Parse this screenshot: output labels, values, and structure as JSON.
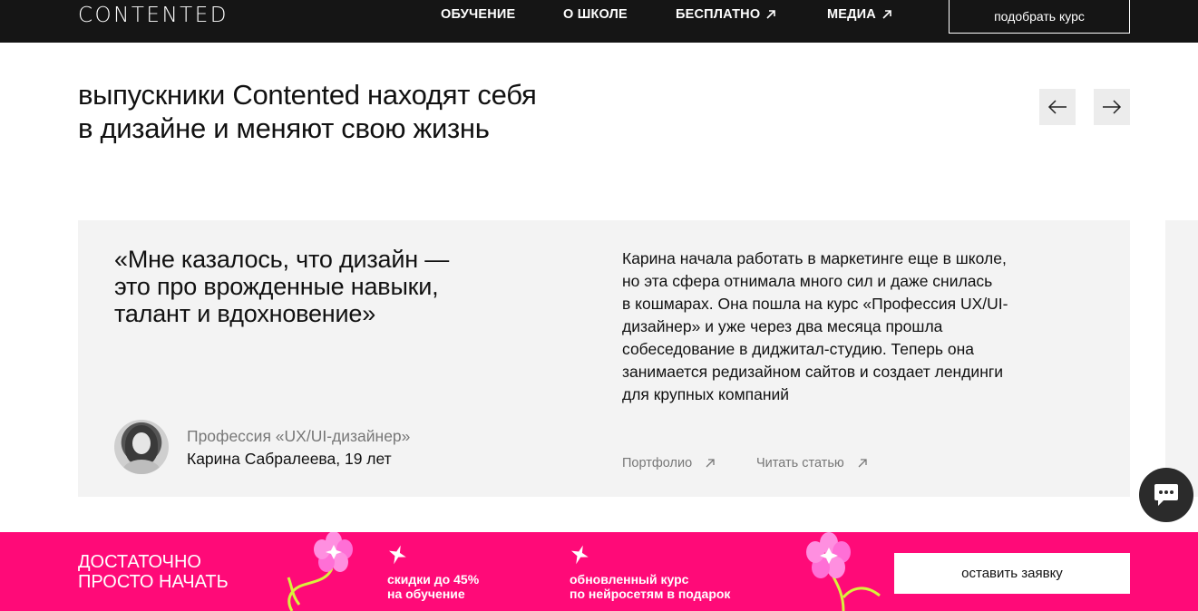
{
  "nav": {
    "logo": "CONTENTED",
    "items": [
      {
        "label": "ОБУЧЕНИЕ"
      },
      {
        "label": "О ШКОЛЕ"
      },
      {
        "label": "БЕСПЛАТНО"
      },
      {
        "label": "МЕДИА"
      }
    ],
    "cta": "подобрать курс"
  },
  "section": {
    "heading_line1": "выпускники Contented находят себя",
    "heading_line2": "в дизайне и меняют свою жизнь"
  },
  "testimonial": {
    "quote_lines": [
      "«Мне казалось, что дизайн —",
      "это про врожденные навыки,",
      "талант и вдохновение»"
    ],
    "story_lines": [
      "Карина начала работать в маркетинге еще в школе,",
      "но эта сфера отнимала много сил и даже снилась",
      "в кошмарах. Она пошла на курс «Профессия UX/UI-",
      "дизайнер» и уже через два месяца прошла",
      "собеседование в диджитал-студию. Теперь она",
      "занимается редизайном сайтов и создает лендинги",
      "для крупных компаний"
    ],
    "profession": "Профессия «UX/UI-дизайнер»",
    "person": "Карина Сабралеева, 19 лет",
    "links": [
      {
        "label": "Портфолио"
      },
      {
        "label": "Читать статью"
      }
    ]
  },
  "promo": {
    "title_line1": "ДОСТАТОЧНО",
    "title_line2": "ПРОСТО НАЧАТЬ",
    "items": [
      {
        "line1": "скидки до 45%",
        "line2": "на обучение"
      },
      {
        "line1": "обновленный курс",
        "line2": "по нейросетям в подарок"
      }
    ],
    "cta": "оставить заявку",
    "accent_color": "#ff0a78"
  },
  "icons": {
    "nav_external": "arrow-up-right-icon",
    "prev": "arrow-left-icon",
    "next": "arrow-right-icon",
    "chat": "chat-icon",
    "sparkle": "sparkle-icon",
    "flower": "flower-icon"
  }
}
